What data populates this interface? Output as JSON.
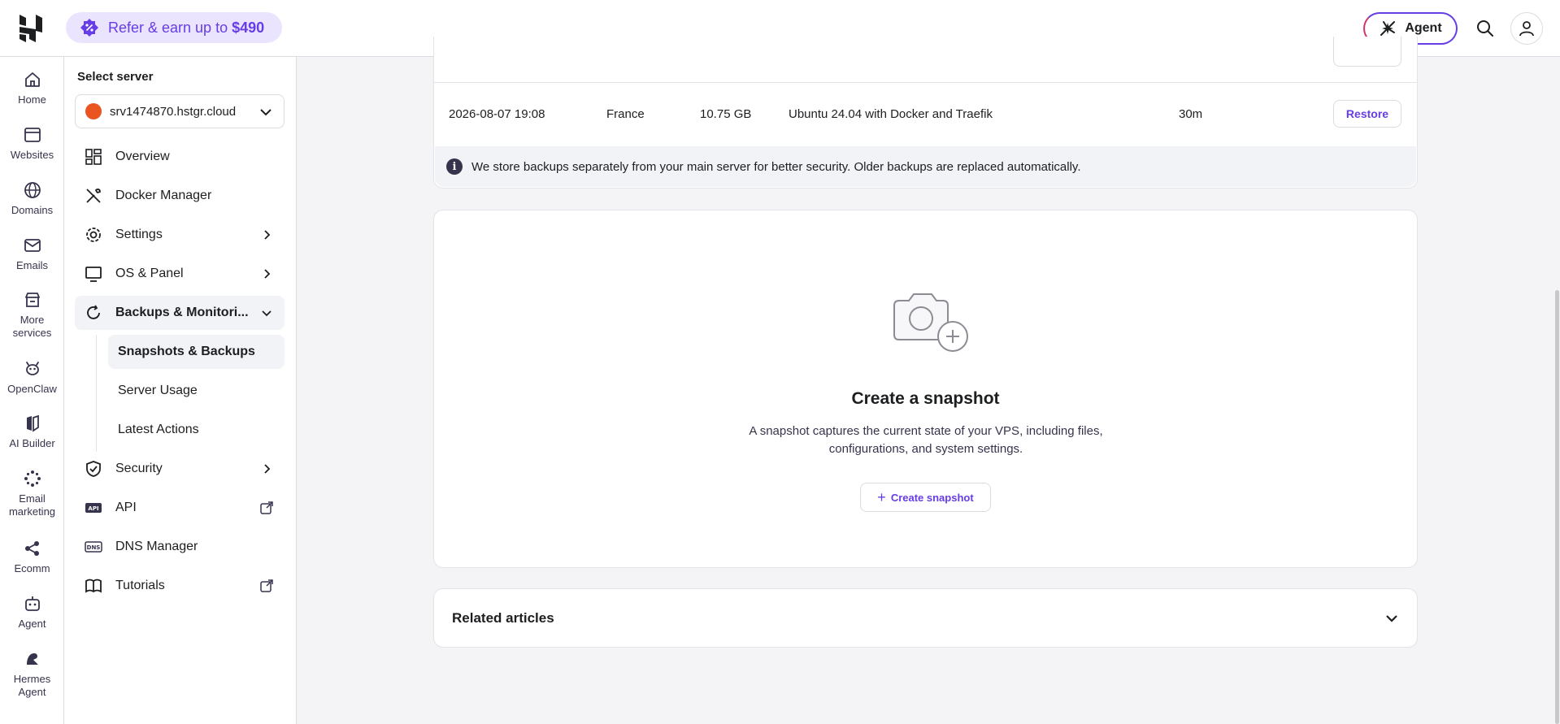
{
  "topbar": {
    "refer_text": "Refer & earn up to",
    "refer_amount": "$490",
    "agent_label": "Agent"
  },
  "rail": {
    "items": [
      {
        "label": "Home",
        "icon": "home-icon"
      },
      {
        "label": "Websites",
        "icon": "browser-icon"
      },
      {
        "label": "Domains",
        "icon": "globe-icon"
      },
      {
        "label": "Emails",
        "icon": "mail-icon"
      },
      {
        "label": "More services",
        "icon": "store-icon"
      },
      {
        "label": "OpenClaw",
        "icon": "openclaw-icon"
      },
      {
        "label": "AI Builder",
        "icon": "ai-builder-icon"
      },
      {
        "label": "Email marketing",
        "icon": "email-marketing-icon"
      },
      {
        "label": "Ecomm",
        "icon": "ecomm-icon"
      },
      {
        "label": "Agent",
        "icon": "agent-bot-icon"
      },
      {
        "label": "Hermes Agent",
        "icon": "hermes-icon"
      }
    ]
  },
  "subnav": {
    "title": "Select server",
    "server": "srv1474870.hstgr.cloud",
    "items": [
      {
        "label": "Overview"
      },
      {
        "label": "Docker Manager"
      },
      {
        "label": "Settings"
      },
      {
        "label": "OS & Panel"
      },
      {
        "label": "Backups & Monitori..."
      },
      {
        "label": "Security"
      },
      {
        "label": "API"
      },
      {
        "label": "DNS Manager"
      },
      {
        "label": "Tutorials"
      }
    ],
    "sub_items": [
      {
        "label": "Snapshots & Backups"
      },
      {
        "label": "Server Usage"
      },
      {
        "label": "Latest Actions"
      }
    ]
  },
  "backups": {
    "row": {
      "date": "2026-08-07 19:08",
      "location": "France",
      "size": "10.75 GB",
      "os": "Ubuntu 24.04 with Docker and Traefik",
      "duration": "30m",
      "action": "Restore"
    },
    "notice": "We store backups separately from your main server for better security. Older backups are replaced automatically."
  },
  "snapshot": {
    "title": "Create a snapshot",
    "description": "A snapshot captures the current state of your VPS, including files, configurations, and system settings.",
    "button": "Create snapshot"
  },
  "related": {
    "title": "Related articles"
  },
  "colors": {
    "accent": "#673de6",
    "accent_light": "#ebe4ff"
  }
}
